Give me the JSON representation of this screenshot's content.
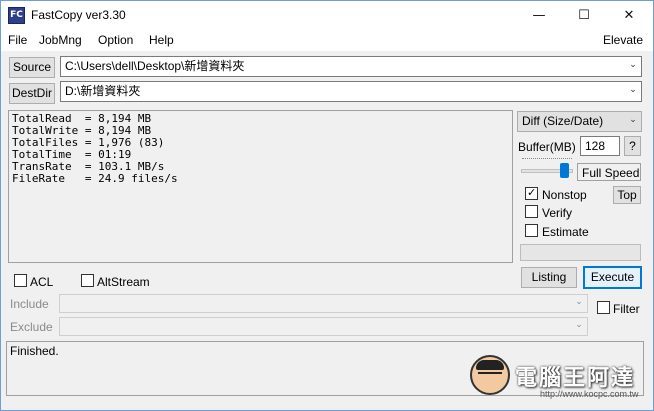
{
  "window": {
    "title": "FastCopy ver3.30",
    "icon_text": "FC"
  },
  "titlebar_buttons": {
    "minimize": "—",
    "maximize": "☐",
    "close": "✕"
  },
  "menu": {
    "items": [
      "File",
      "JobMng",
      "Option",
      "Help"
    ],
    "right": "Elevate"
  },
  "source": {
    "label": "Source",
    "value": "C:\\Users\\dell\\Desktop\\新增資料夾"
  },
  "dest": {
    "label": "DestDir",
    "value": "D:\\新增資料夾"
  },
  "stats": [
    "TotalRead  = 8,194 MB",
    "TotalWrite = 8,194 MB",
    "TotalFiles = 1,976 (83)",
    "TotalTime  = 01:19",
    "TransRate  = 103.1 MB/s",
    "FileRate   = 24.9 files/s"
  ],
  "mode": {
    "selected": "Diff (Size/Date)"
  },
  "buffer": {
    "label": "Buffer(MB)",
    "value": "128",
    "help": "?"
  },
  "speed": {
    "label": "Full Speed",
    "level": 1.0
  },
  "options": {
    "nonstop": {
      "label": "Nonstop",
      "checked": true
    },
    "top": "Top",
    "verify": {
      "label": "Verify",
      "checked": false
    },
    "estimate": {
      "label": "Estimate",
      "checked": false
    }
  },
  "actions": {
    "listing": "Listing",
    "execute": "Execute"
  },
  "filters": {
    "acl": {
      "label": "ACL",
      "checked": false
    },
    "altstream": {
      "label": "AltStream",
      "checked": false
    },
    "include_label": "Include",
    "exclude_label": "Exclude",
    "filter": {
      "label": "Filter",
      "checked": false
    }
  },
  "status": {
    "text": "Finished."
  },
  "watermark": {
    "text": "電腦王阿達",
    "url": "http://www.kocpc.com.tw"
  }
}
